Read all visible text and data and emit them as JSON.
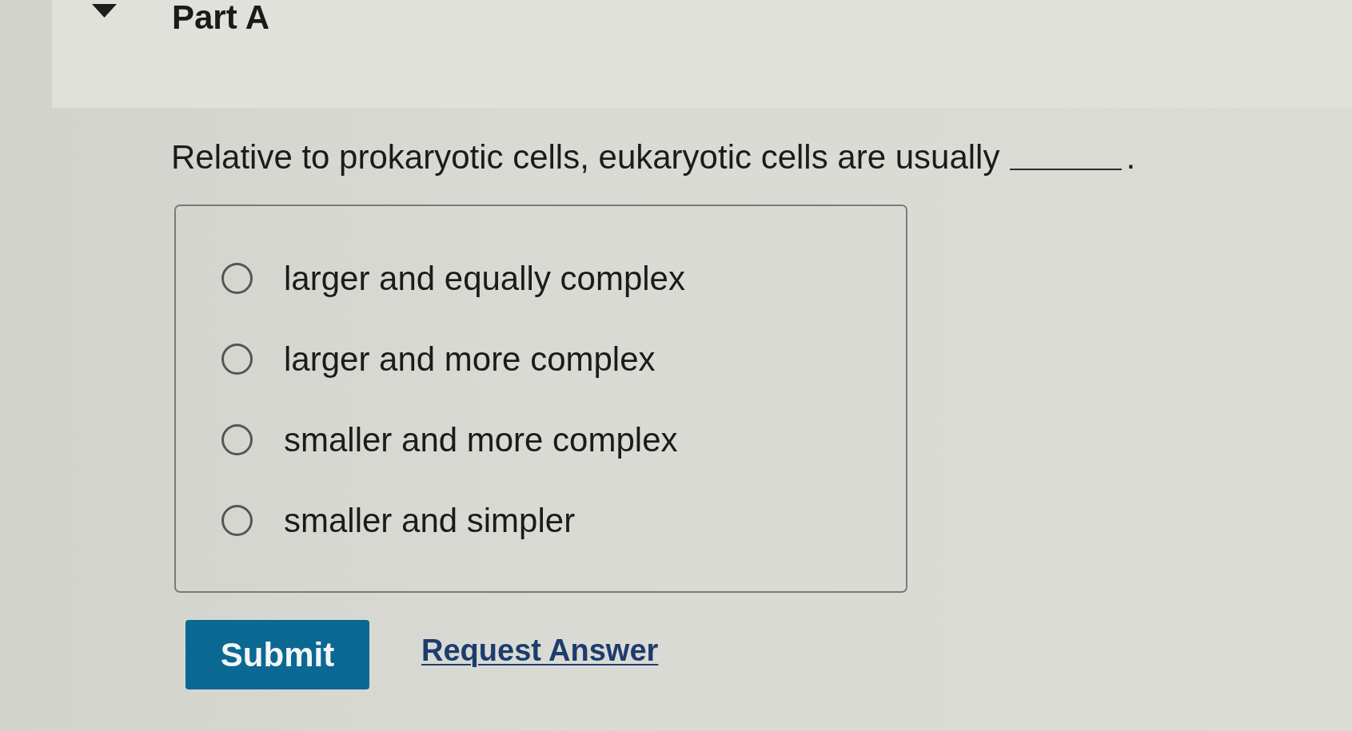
{
  "part": {
    "title": "Part A",
    "expanded": true
  },
  "question": {
    "text_before": "Relative to prokaryotic cells, eukaryotic cells are usually",
    "text_after": "."
  },
  "options": [
    {
      "label": "larger and equally complex",
      "selected": false
    },
    {
      "label": "larger and more complex",
      "selected": false
    },
    {
      "label": "smaller and more complex",
      "selected": false
    },
    {
      "label": "smaller and simpler",
      "selected": false
    }
  ],
  "actions": {
    "submit": "Submit",
    "request_answer": "Request Answer"
  }
}
